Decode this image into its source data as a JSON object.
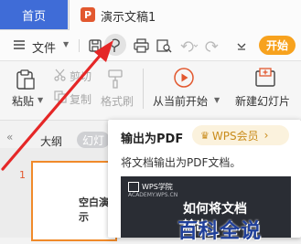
{
  "tabs": {
    "home": "首页",
    "document": "演示文稿1",
    "doc_icon_letter": "P"
  },
  "toolbar": {
    "file_label": "文件",
    "start_label": "开始",
    "icons": [
      "menu-icon",
      "save-icon",
      "export-pdf-icon",
      "print-icon",
      "print-preview-icon",
      "undo-icon",
      "redo-icon",
      "customize-toolbar-icon"
    ]
  },
  "ribbon": {
    "paste": "粘贴",
    "cut": "剪切",
    "copy": "复制",
    "format_painter": "格式刷",
    "from_current": "从当前开始",
    "new_slide": "新建幻灯片"
  },
  "panel": {
    "outline_tab": "大纲",
    "slides_tab": "幻灯",
    "slide_number": "1",
    "slide_thumb_text": "空白演示"
  },
  "tooltip": {
    "title": "输出为PDF",
    "badge": "WPS会员",
    "badge_arrow": "›",
    "description": "将文档输出为PDF文档。",
    "video_brand": "WPS学院",
    "video_sub": "ACADEMY.WPS.CN",
    "video_heading_line1": "如何将文档",
    "video_heading_line2": "输出"
  },
  "watermark": "百科全说",
  "colors": {
    "home_tab": "#3f6cd7",
    "start_button": "#f7a21e",
    "doc_icon": "#e2582f",
    "arrow": "#e52727"
  }
}
